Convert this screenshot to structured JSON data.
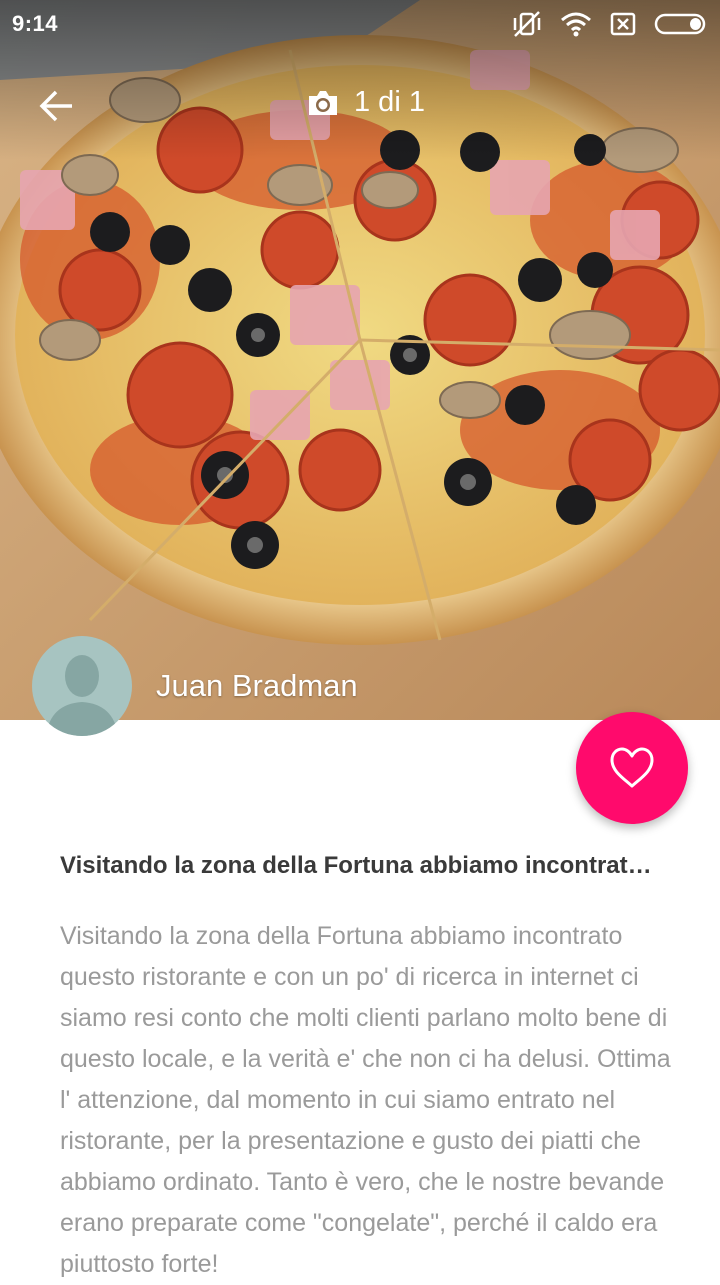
{
  "status": {
    "time": "9:14"
  },
  "header": {
    "photo_counter": "1 di 1"
  },
  "author": {
    "name": "Juan Bradman"
  },
  "review": {
    "title": "Visitando la zona della Fortuna abbiamo incontrato questo ristorante",
    "body": "Visitando la zona della Fortuna abbiamo incontrato questo ristorante e con un po' di ricerca in internet ci siamo resi conto che molti clienti parlano molto bene di questo locale, e la verità e' che non ci ha delusi. Ottima l' attenzione, dal momento in cui siamo entrato nel ristorante, per la presentazione e gusto dei piatti che abbiamo ordinato. Tanto è vero, che le nostre bevande erano preparate come \"congelate\", perché il caldo era piuttosto forte!"
  },
  "colors": {
    "accent": "#ff0a6c",
    "avatar_bg": "#a7c4c1",
    "title": "#3a3a3a",
    "body": "#9a9a9a"
  },
  "icons": [
    "back-arrow-icon",
    "camera-icon",
    "heart-outline-icon",
    "vibrate-off-icon",
    "wifi-icon",
    "sim-off-icon",
    "battery-icon"
  ]
}
